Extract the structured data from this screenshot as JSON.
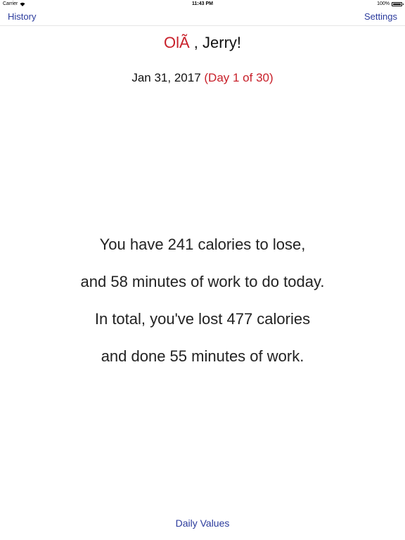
{
  "status_bar": {
    "carrier": "Carrier",
    "time": "11:43 PM",
    "battery": "100%",
    "icons": [
      "wifi-icon",
      "battery-icon"
    ]
  },
  "nav": {
    "left_label": "History",
    "right_label": "Settings"
  },
  "greeting": {
    "word": "OlÃ",
    "name": " , Jerry!"
  },
  "date": {
    "text": "Jan 31, 2017",
    "day_progress": "(Day 1 of 30)"
  },
  "summary": {
    "line1": "You have 241 calories to lose,",
    "line2": "and 58 minutes of work to do today.",
    "line3": "In total, you've lost 477 calories",
    "line4": "and done 55 minutes of work."
  },
  "footer": {
    "daily_values_label": "Daily Values"
  },
  "colors": {
    "accent_blue": "#2a3a9c",
    "accent_red": "#c8202a"
  }
}
